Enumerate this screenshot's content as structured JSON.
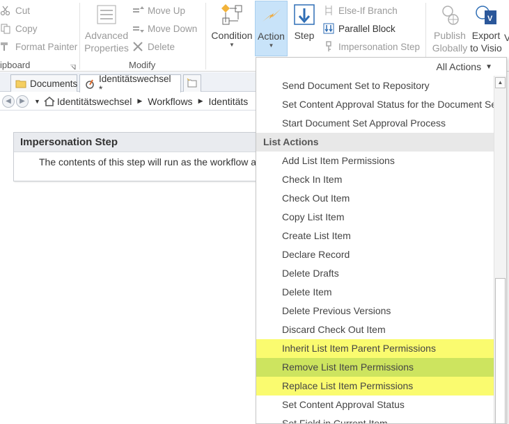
{
  "ribbon": {
    "clipboard": {
      "cut": "Cut",
      "copy": "Copy",
      "format_painter": "Format Painter",
      "group_label": "ipboard"
    },
    "modify": {
      "advanced_properties_line1": "Advanced",
      "advanced_properties_line2": "Properties",
      "move_up": "Move Up",
      "move_down": "Move Down",
      "delete": "Delete",
      "group_label": "Modify"
    },
    "insert": {
      "condition": "Condition",
      "action": "Action",
      "step": "Step",
      "else_if_branch": "Else-If Branch",
      "parallel_block": "Parallel Block",
      "impersonation_step": "Impersonation Step"
    },
    "manage": {
      "publish_line1": "Publish",
      "publish_line2": "Globally",
      "export_line1": "Export",
      "export_line2": "to Visio",
      "cut_off_letter": "V"
    }
  },
  "tabs": [
    {
      "label": "Documents",
      "icon": "folder-icon"
    },
    {
      "label": "Identitätswechsel *",
      "icon": "workflow-icon"
    }
  ],
  "breadcrumb": {
    "items": [
      "Identitätswechsel",
      "Workflows",
      "Identitäts"
    ]
  },
  "step_box": {
    "title": "Impersonation Step",
    "body": "The contents of this step will run as the workflow aut"
  },
  "dropdown": {
    "filter_label": "All Actions",
    "items_before": [
      "Send Document Set to Repository",
      "Set Content Approval Status for the Document Set",
      "Start Document Set Approval Process"
    ],
    "section_title": "List Actions",
    "list_items": [
      "Add List Item Permissions",
      "Check In Item",
      "Check Out Item",
      "Copy List Item",
      "Create List Item",
      "Declare Record",
      "Delete Drafts",
      "Delete Item",
      "Delete Previous Versions",
      "Discard Check Out Item",
      "Inherit List Item Parent Permissions",
      "Remove List Item Permissions",
      "Replace List Item Permissions",
      "Set Content Approval Status",
      "Set Field in Current Item"
    ],
    "highlight_colors": {
      "yellow": "#fafb6f",
      "green": "#cde45f"
    }
  }
}
